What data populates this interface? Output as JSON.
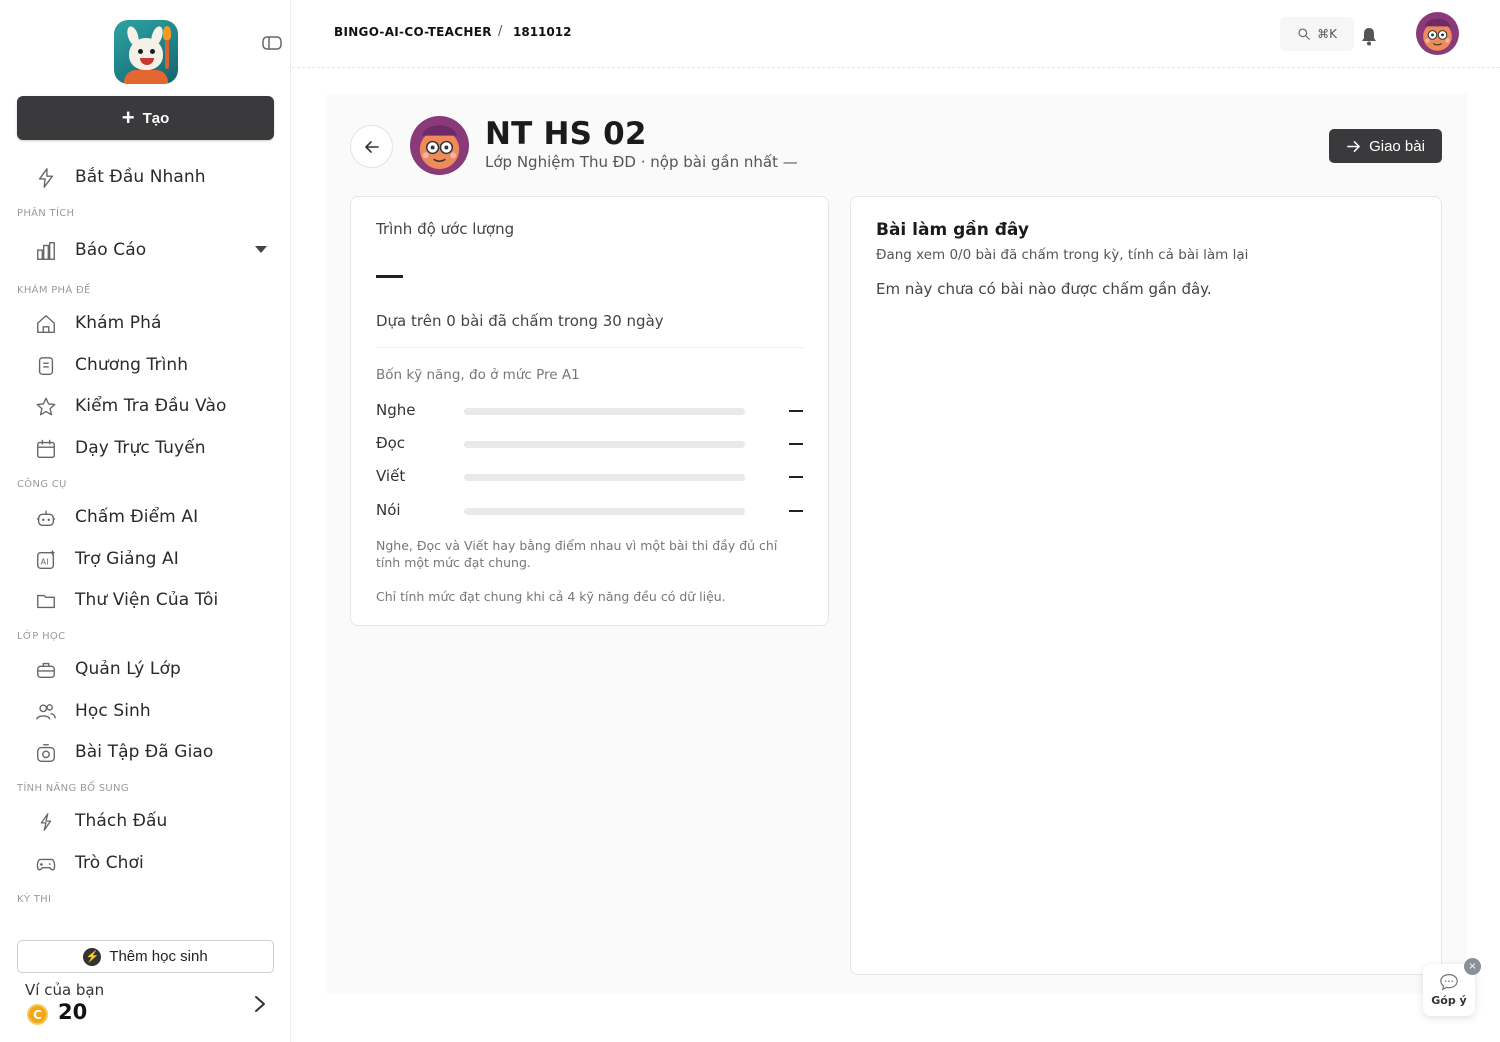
{
  "sidebar": {
    "create_label": "Tạo",
    "quick_start": "Bắt Đầu Nhanh",
    "sections": {
      "analysis": "PHÂN TÍCH",
      "explore": "KHÁM PHÁ ĐỀ",
      "tools": "CÔNG CỤ",
      "class": "LỚP HỌC",
      "extra": "TÍNH NĂNG BỔ SUNG",
      "exam": "KỲ THI"
    },
    "items": {
      "reports": "Báo Cáo",
      "explore": "Khám Phá",
      "curriculum": "Chương Trình",
      "placement": "Kiểm Tra Đầu Vào",
      "online": "Dạy Trực Tuyến",
      "ai_grading": "Chấm Điểm AI",
      "ai_assistant": "Trợ Giảng AI",
      "library": "Thư Viện Của Tôi",
      "class_manage": "Quản Lý Lớp",
      "students": "Học Sinh",
      "assignments": "Bài Tập Đã Giao",
      "challenge": "Thách Đấu",
      "games": "Trò Chơi"
    },
    "add_student": "Thêm học sinh",
    "wallet_label": "Ví của bạn",
    "wallet_coin": "C",
    "wallet_value": "20"
  },
  "header": {
    "breadcrumb_org": "BINGO-AI-CO-TEACHER",
    "breadcrumb_sep": "/",
    "breadcrumb_id": "1811012",
    "search_shortcut": "⌘K"
  },
  "student": {
    "name": "NT HS 02",
    "subtitle": "Lớp Nghiệm Thu ĐD · nộp bài gần nhất —",
    "assign_label": "Giao bài"
  },
  "level_card": {
    "title": "Trình độ ước lượng",
    "basis": "Dựa trên 0 bài đã chấm trong 30 ngày",
    "skills_heading": "Bốn kỹ năng, đo ở mức Pre A1",
    "skills": [
      {
        "name": "Nghe",
        "level": 0
      },
      {
        "name": "Đọc",
        "level": 0
      },
      {
        "name": "Viết",
        "level": 0
      },
      {
        "name": "Nói",
        "level": 0
      }
    ],
    "note1": "Nghe, Đọc và Viết hay bằng điểm nhau vì một bài thi đầy đủ chỉ tính một mức đạt chung.",
    "note2": "Chỉ tính mức đạt chung khi cả 4 kỹ năng đều có dữ liệu."
  },
  "recent_card": {
    "title": "Bài làm gần đây",
    "subtitle": "Đang xem 0/0 bài đã chấm trong kỳ, tính cả bài làm lại",
    "empty": "Em này chưa có bài nào được chấm gần đây."
  },
  "feedback": {
    "label": "Góp ý",
    "close": "×"
  },
  "colors": {
    "primary_dark": "#3a3a3c",
    "coin": "#f3a712",
    "bar_track": "#e9e9e9"
  }
}
